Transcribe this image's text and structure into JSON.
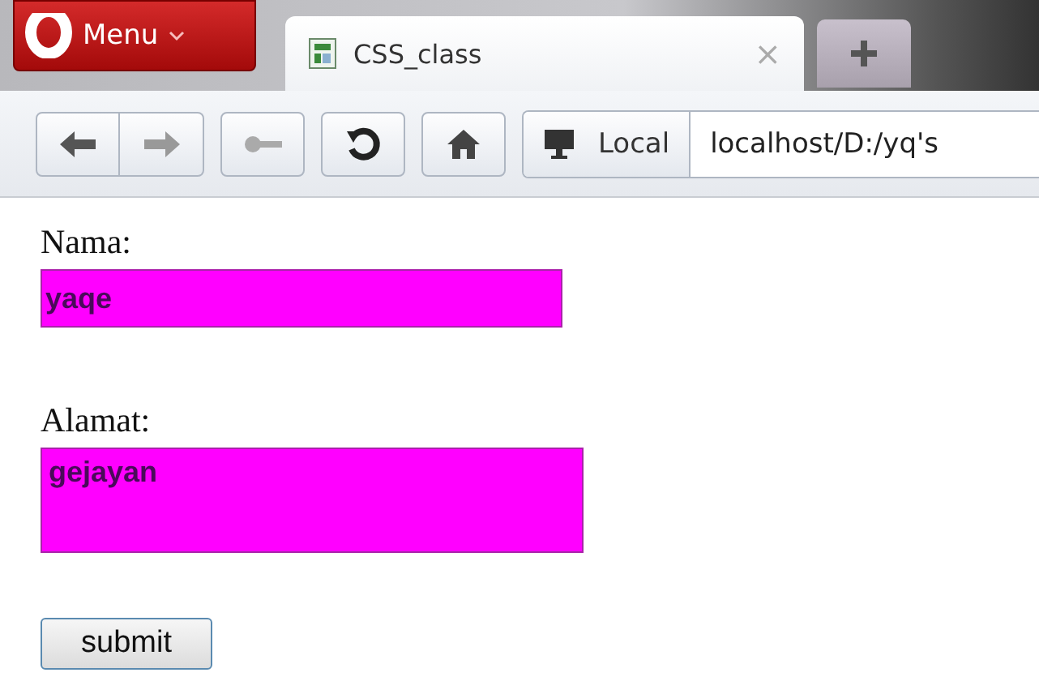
{
  "browser": {
    "menu_button": "Menu",
    "tab": {
      "title": "CSS_class",
      "close": "×"
    },
    "address": {
      "badge": "Local",
      "url": "localhost/D:/yq's"
    }
  },
  "form": {
    "fields": [
      {
        "kind": "input",
        "label": "Nama:",
        "value": "yaqe"
      },
      {
        "kind": "textarea",
        "label": "Alamat:",
        "value": "gejayan"
      }
    ],
    "submit": "submit"
  }
}
